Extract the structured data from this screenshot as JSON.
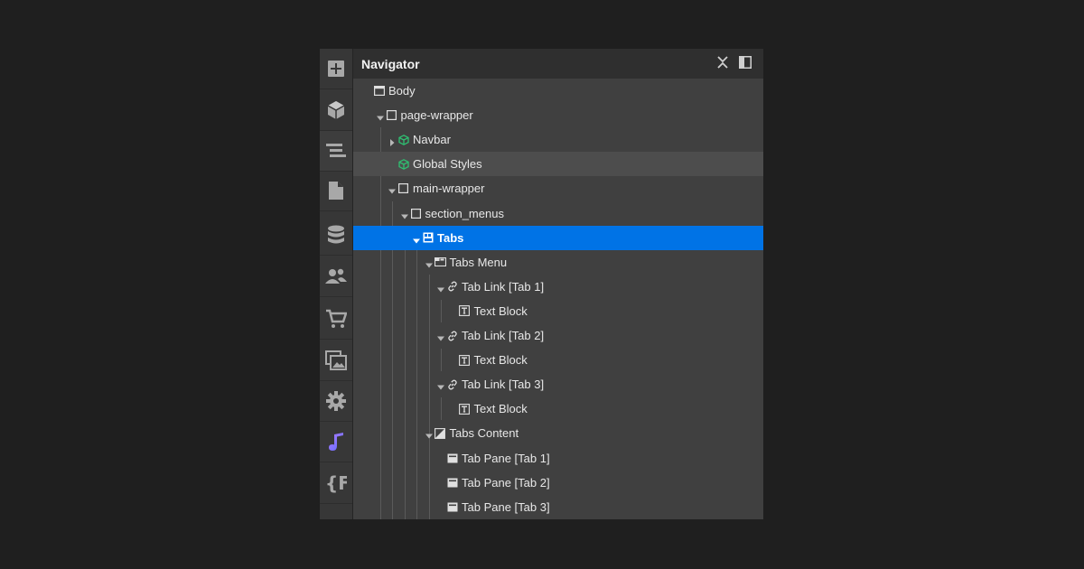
{
  "panel": {
    "title": "Navigator",
    "collapse_icon": "collapse-all-icon",
    "dock_icon": "dock-panel-icon"
  },
  "rail": [
    {
      "icon": "add-icon"
    },
    {
      "icon": "components-cube-icon"
    },
    {
      "icon": "navigator-icon",
      "active": true
    },
    {
      "icon": "pages-icon"
    },
    {
      "icon": "cms-database-icon"
    },
    {
      "icon": "users-icon"
    },
    {
      "icon": "ecommerce-cart-icon"
    },
    {
      "icon": "assets-icon"
    },
    {
      "icon": "settings-gear-icon"
    },
    {
      "icon": "app-logo-icon"
    },
    {
      "icon": "finsweet-attributes-icon"
    }
  ],
  "tree": [
    {
      "label": "Body",
      "icon": "body-icon"
    },
    {
      "label": "page-wrapper",
      "icon": "div-block-icon",
      "expanded": true
    },
    {
      "label": "Navbar",
      "icon": "component-icon",
      "expanded": false
    },
    {
      "label": "Global Styles",
      "icon": "component-icon",
      "state": "hover"
    },
    {
      "label": "main-wrapper",
      "icon": "div-block-icon",
      "expanded": true
    },
    {
      "label": "section_menus",
      "icon": "div-block-icon",
      "expanded": true
    },
    {
      "label": "Tabs",
      "icon": "tabs-icon",
      "expanded": true,
      "state": "selected"
    },
    {
      "label": "Tabs Menu",
      "icon": "tabs-menu-icon",
      "expanded": true
    },
    {
      "label": "Tab Link [Tab 1]",
      "icon": "link-icon",
      "expanded": true
    },
    {
      "label": "Text Block",
      "icon": "text-block-icon"
    },
    {
      "label": "Tab Link [Tab 2]",
      "icon": "link-icon",
      "expanded": true
    },
    {
      "label": "Text Block",
      "icon": "text-block-icon"
    },
    {
      "label": "Tab Link [Tab 3]",
      "icon": "link-icon",
      "expanded": true
    },
    {
      "label": "Text Block",
      "icon": "text-block-icon"
    },
    {
      "label": "Tabs Content",
      "icon": "tabs-content-icon",
      "expanded": true
    },
    {
      "label": "Tab Pane [Tab 1]",
      "icon": "tab-pane-icon"
    },
    {
      "label": "Tab Pane [Tab 2]",
      "icon": "tab-pane-icon"
    },
    {
      "label": "Tab Pane [Tab 3]",
      "icon": "tab-pane-icon"
    }
  ],
  "colors": {
    "selected": "#0073e6",
    "component": "#2fbf71",
    "accent_logo": "#8c6cff"
  }
}
